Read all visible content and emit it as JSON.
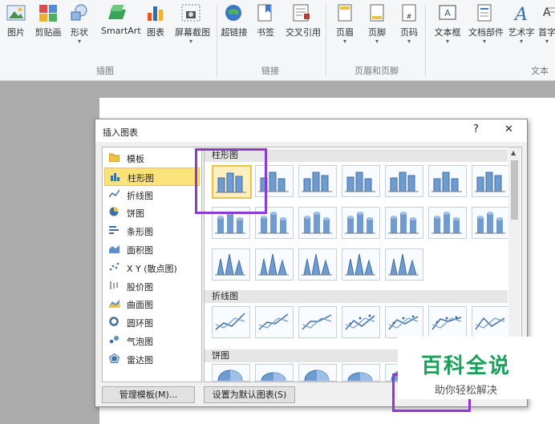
{
  "ribbon": {
    "buttons": [
      {
        "label": "图片",
        "icon": "picture-icon",
        "dropdown": false
      },
      {
        "label": "剪贴画",
        "icon": "clipart-icon",
        "dropdown": false
      },
      {
        "label": "形状",
        "icon": "shapes-icon",
        "dropdown": true
      },
      {
        "label": "SmartArt",
        "icon": "smartart-icon",
        "dropdown": false
      },
      {
        "label": "图表",
        "icon": "chart-icon",
        "dropdown": false
      },
      {
        "label": "屏幕截图",
        "icon": "screenshot-icon",
        "dropdown": true
      },
      {
        "label": "超链接",
        "icon": "hyperlink-icon",
        "dropdown": false
      },
      {
        "label": "书签",
        "icon": "bookmark-icon",
        "dropdown": false
      },
      {
        "label": "交叉引用",
        "icon": "cross-reference-icon",
        "dropdown": false
      },
      {
        "label": "页眉",
        "icon": "header-icon",
        "dropdown": true
      },
      {
        "label": "页脚",
        "icon": "footer-icon",
        "dropdown": true
      },
      {
        "label": "页码",
        "icon": "page-number-icon",
        "dropdown": true
      },
      {
        "label": "文本框",
        "icon": "textbox-icon",
        "dropdown": true
      },
      {
        "label": "文档部件",
        "icon": "quick-parts-icon",
        "dropdown": true
      },
      {
        "label": "艺术字",
        "icon": "wordart-icon",
        "dropdown": true
      },
      {
        "label": "首字",
        "icon": "drop-cap-icon",
        "dropdown": true
      }
    ],
    "groups": {
      "illustrations": "插图",
      "links": "链接",
      "header_footer": "页眉和页脚",
      "text": "文本"
    }
  },
  "dialog": {
    "title": "插入图表",
    "help_label": "?",
    "close_label": "✕",
    "chart_types": [
      {
        "label": "模板",
        "icon": "folder-icon"
      },
      {
        "label": "柱形图",
        "icon": "column-chart-icon"
      },
      {
        "label": "折线图",
        "icon": "line-chart-icon"
      },
      {
        "label": "饼图",
        "icon": "pie-chart-icon"
      },
      {
        "label": "条形图",
        "icon": "bar-chart-icon"
      },
      {
        "label": "面积图",
        "icon": "area-chart-icon"
      },
      {
        "label": "X Y (散点图)",
        "icon": "scatter-chart-icon"
      },
      {
        "label": "股价图",
        "icon": "stock-chart-icon"
      },
      {
        "label": "曲面图",
        "icon": "surface-chart-icon"
      },
      {
        "label": "圆环图",
        "icon": "doughnut-chart-icon"
      },
      {
        "label": "气泡图",
        "icon": "bubble-chart-icon"
      },
      {
        "label": "雷达图",
        "icon": "radar-chart-icon"
      }
    ],
    "selected_type": "柱形图",
    "sections": {
      "column": "柱形图",
      "line": "折线图",
      "pie": "饼图"
    },
    "manage_templates_label": "管理模板(M)...",
    "set_default_label": "设置为默认图表(S)",
    "colors": {
      "selection": "#fbe27a",
      "highlight_box": "#8c3bd1"
    }
  },
  "watermark": {
    "main": "百科全说",
    "sub": "助你轻松解决",
    "color": "#1aa05a"
  }
}
